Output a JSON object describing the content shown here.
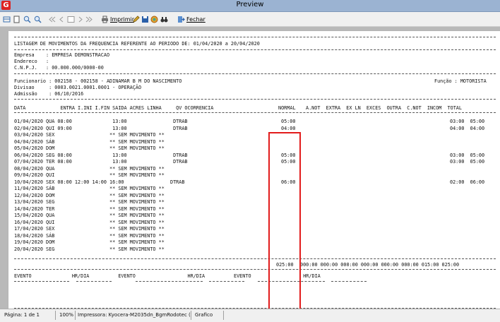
{
  "window": {
    "title": "Preview",
    "icon_letter": "G"
  },
  "toolbar": {
    "print_label": "Imprimir",
    "close_label": "Fechar"
  },
  "report": {
    "title": "LISTAGEM DE MOVIMENTOS DA FREQUENCIA REFERENTE AO PERIODO DE: 01/04/2020 a 20/04/2020",
    "empresa": "Empresa    : EMPRESA DEMONSTRACAO",
    "endereco": "Endereco   :",
    "cnpj": "C.N.P.J.   : 00.000.000/0000-00",
    "funcionario": "Funcionario : 002158 - 002158 - ADINAMAR B M DO NASCIMENTO",
    "funcao": "Função : MOTORISTA",
    "divisao": "Divisao     : 0003.0021.0001.0001 - OPERAÇÃO",
    "admissao": "Admissão    : 06/10/2016",
    "header_left": "DATA            ENTRA I.INI I.FIN SAIDA ACRES LINHA     QV OCORRENCIA",
    "header_normal": "NORMAL",
    "header_right": "A.NOT  EXTRA  EX LN  EXCES  OUTRA  C.NOT  INCOM  TOTAL",
    "rows": [
      {
        "left": "01/04/2020 QUA 08:00              13:00                DTRAB",
        "normal": "05:00",
        "right": "03:00  05:00"
      },
      {
        "left": "02/04/2020 QUI 09:00              13:00                DTRAB",
        "normal": "04:00",
        "right": "04:00  04:00"
      },
      {
        "left": "03/04/2020 SEX                   ** SEM MOVIMENTO **",
        "normal": "",
        "right": ""
      },
      {
        "left": "04/04/2020 SÁB                   ** SEM MOVIMENTO **",
        "normal": "",
        "right": ""
      },
      {
        "left": "05/04/2020 DOM                   ** SEM MOVIMENTO **",
        "normal": "",
        "right": ""
      },
      {
        "left": "06/04/2020 SEG 08:00              13:00                DTRAB",
        "normal": "05:00",
        "right": "03:00  05:00"
      },
      {
        "left": "07/04/2020 TER 08:00              13:00                DTRAB",
        "normal": "05:00",
        "right": "03:00  05:00"
      },
      {
        "left": "08/04/2020 QUA                   ** SEM MOVIMENTO **",
        "normal": "",
        "right": ""
      },
      {
        "left": "09/04/2020 QUI                   ** SEM MOVIMENTO **",
        "normal": "",
        "right": ""
      },
      {
        "left": "10/04/2020 SEX 08:00 12:00 14:00 16:00                DTRAB",
        "normal": "06:00",
        "right": "02:00  06:00"
      },
      {
        "left": "11/04/2020 SÁB                   ** SEM MOVIMENTO **",
        "normal": "",
        "right": ""
      },
      {
        "left": "12/04/2020 DOM                   ** SEM MOVIMENTO **",
        "normal": "",
        "right": ""
      },
      {
        "left": "13/04/2020 SEG                   ** SEM MOVIMENTO **",
        "normal": "",
        "right": ""
      },
      {
        "left": "14/04/2020 TER                   ** SEM MOVIMENTO **",
        "normal": "",
        "right": ""
      },
      {
        "left": "15/04/2020 QUA                   ** SEM MOVIMENTO **",
        "normal": "",
        "right": ""
      },
      {
        "left": "16/04/2020 QUI                   ** SEM MOVIMENTO **",
        "normal": "",
        "right": ""
      },
      {
        "left": "17/04/2020 SEX                   ** SEM MOVIMENTO **",
        "normal": "",
        "right": ""
      },
      {
        "left": "18/04/2020 SÁB                   ** SEM MOVIMENTO **",
        "normal": "",
        "right": ""
      },
      {
        "left": "19/04/2020 DOM                   ** SEM MOVIMENTO **",
        "normal": "",
        "right": ""
      },
      {
        "left": "20/04/2020 SEG                   ** SEM MOVIMENTO **",
        "normal": "",
        "right": ""
      }
    ],
    "total_normal": "025:00",
    "total_right": "000:00 000:00 000:00 000:00 000:00 000:00 015:00 025:00",
    "evento_header": "EVENTO              HR/DIA          EVENTO                  HR/DIA          EVENTO                  HR/DIA"
  },
  "status": {
    "page": "Página: 1 de 1",
    "zoom": "100%",
    "printer": "Impressora: Kyocera-M2035dn_BgmRodotec (",
    "mode": "Grafico"
  }
}
